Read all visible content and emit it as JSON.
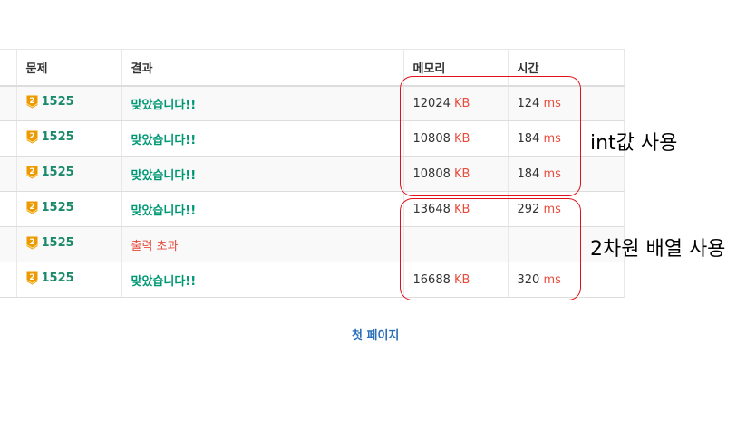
{
  "table": {
    "headers": {
      "problem": "문제",
      "result": "결과",
      "memory": "메모리",
      "time": "시간"
    },
    "rows": [
      {
        "tier_badge": "2",
        "problem_id": "1525",
        "result": "맞았습니다!!",
        "result_type": "ok",
        "memory_value": "12024",
        "memory_unit": "KB",
        "time_value": "124",
        "time_unit": "ms"
      },
      {
        "tier_badge": "2",
        "problem_id": "1525",
        "result": "맞았습니다!!",
        "result_type": "ok",
        "memory_value": "10808",
        "memory_unit": "KB",
        "time_value": "184",
        "time_unit": "ms"
      },
      {
        "tier_badge": "2",
        "problem_id": "1525",
        "result": "맞았습니다!!",
        "result_type": "ok",
        "memory_value": "10808",
        "memory_unit": "KB",
        "time_value": "184",
        "time_unit": "ms"
      },
      {
        "tier_badge": "2",
        "problem_id": "1525",
        "result": "맞았습니다!!",
        "result_type": "ok",
        "memory_value": "13648",
        "memory_unit": "KB",
        "time_value": "292",
        "time_unit": "ms"
      },
      {
        "tier_badge": "2",
        "problem_id": "1525",
        "result": "출력 초과",
        "result_type": "fail",
        "memory_value": "",
        "memory_unit": "",
        "time_value": "",
        "time_unit": ""
      },
      {
        "tier_badge": "2",
        "problem_id": "1525",
        "result": "맞았습니다!!",
        "result_type": "ok",
        "memory_value": "16688",
        "memory_unit": "KB",
        "time_value": "320",
        "time_unit": "ms"
      }
    ]
  },
  "annotations": {
    "int_label": "int값 사용",
    "array_label": "2차원 배열 사용"
  },
  "pager": {
    "first_page": "첫 페이지"
  },
  "colors": {
    "accepted": "#009874",
    "rejected": "#e74c3c",
    "unit": "#e74c3c",
    "annotation": "#e0111a",
    "tier_gold": "#ec9a00",
    "link": "#2a6fb8"
  },
  "icons": {
    "tier": "gold-tier-badge-icon"
  }
}
